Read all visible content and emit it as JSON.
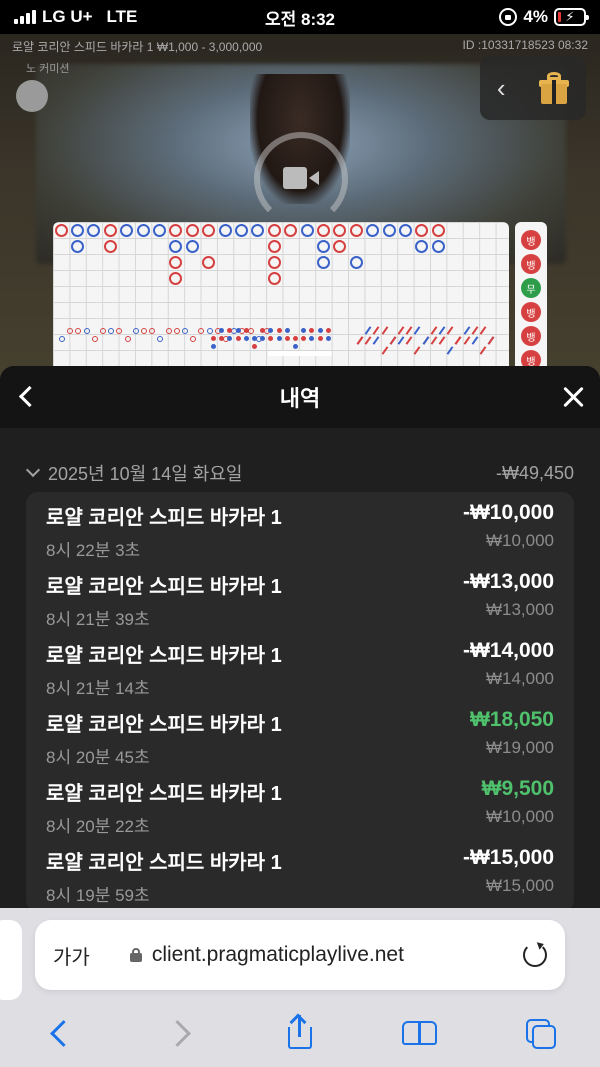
{
  "status_bar": {
    "carrier": "LG U+",
    "network": "LTE",
    "time": "오전 8:32",
    "battery_percent": "4%",
    "battery_level": 0.04
  },
  "game": {
    "table_info": "로얄 코리안 스피드 바카라 1 ₩1,000 - 3,000,000",
    "round_id": "ID :10331718523 08:32",
    "commission": "노 커미션",
    "side_road": [
      "뱅",
      "뱅",
      "무",
      "뱅",
      "뱅",
      "뱅"
    ]
  },
  "history": {
    "title": "내역",
    "date": "2025년 10월 14일 화요일",
    "day_total": "-₩49,450",
    "bets": [
      {
        "name": "로얄 코리안 스피드 바카라 1",
        "time": "8시 22분 3초",
        "result": "-₩10,000",
        "stake": "₩10,000",
        "win": false
      },
      {
        "name": "로얄 코리안 스피드 바카라 1",
        "time": "8시 21분 39초",
        "result": "-₩13,000",
        "stake": "₩13,000",
        "win": false
      },
      {
        "name": "로얄 코리안 스피드 바카라 1",
        "time": "8시 21분 14초",
        "result": "-₩14,000",
        "stake": "₩14,000",
        "win": false
      },
      {
        "name": "로얄 코리안 스피드 바카라 1",
        "time": "8시 20분 45초",
        "result": "₩18,050",
        "stake": "₩19,000",
        "win": true
      },
      {
        "name": "로얄 코리안 스피드 바카라 1",
        "time": "8시 20분 22초",
        "result": "₩9,500",
        "stake": "₩10,000",
        "win": true
      },
      {
        "name": "로얄 코리안 스피드 바카라 1",
        "time": "8시 19분 59초",
        "result": "-₩15,000",
        "stake": "₩15,000",
        "win": false
      }
    ]
  },
  "browser": {
    "text_size_label": "가가",
    "url": "client.pragmaticplaylive.net"
  },
  "colors": {
    "win": "#4fc06b",
    "banker": "#d64040",
    "player": "#3a62c9",
    "tie": "#2e9d4a",
    "accent": "#1a73e8"
  }
}
